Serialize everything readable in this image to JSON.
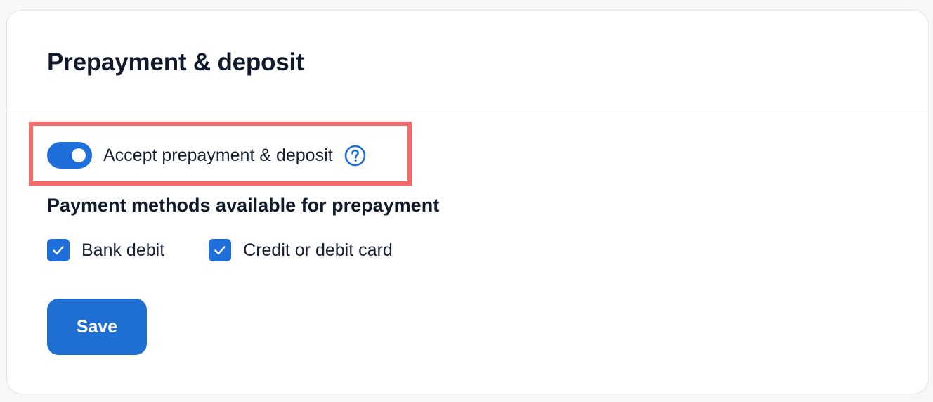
{
  "card": {
    "title": "Prepayment & deposit"
  },
  "prepayment_toggle": {
    "label": "Accept prepayment & deposit",
    "state": "on",
    "icon": "toggle-switch",
    "help_icon": "question-circle-icon"
  },
  "payment_methods": {
    "heading": "Payment methods available for prepayment",
    "options": [
      {
        "label": "Bank debit",
        "checked": true
      },
      {
        "label": "Credit or debit card",
        "checked": true
      }
    ]
  },
  "actions": {
    "save_label": "Save"
  },
  "colors": {
    "accent": "#1e6fd9",
    "highlight": "#f76a6a",
    "text": "#172033",
    "border": "#dfe3e8"
  }
}
